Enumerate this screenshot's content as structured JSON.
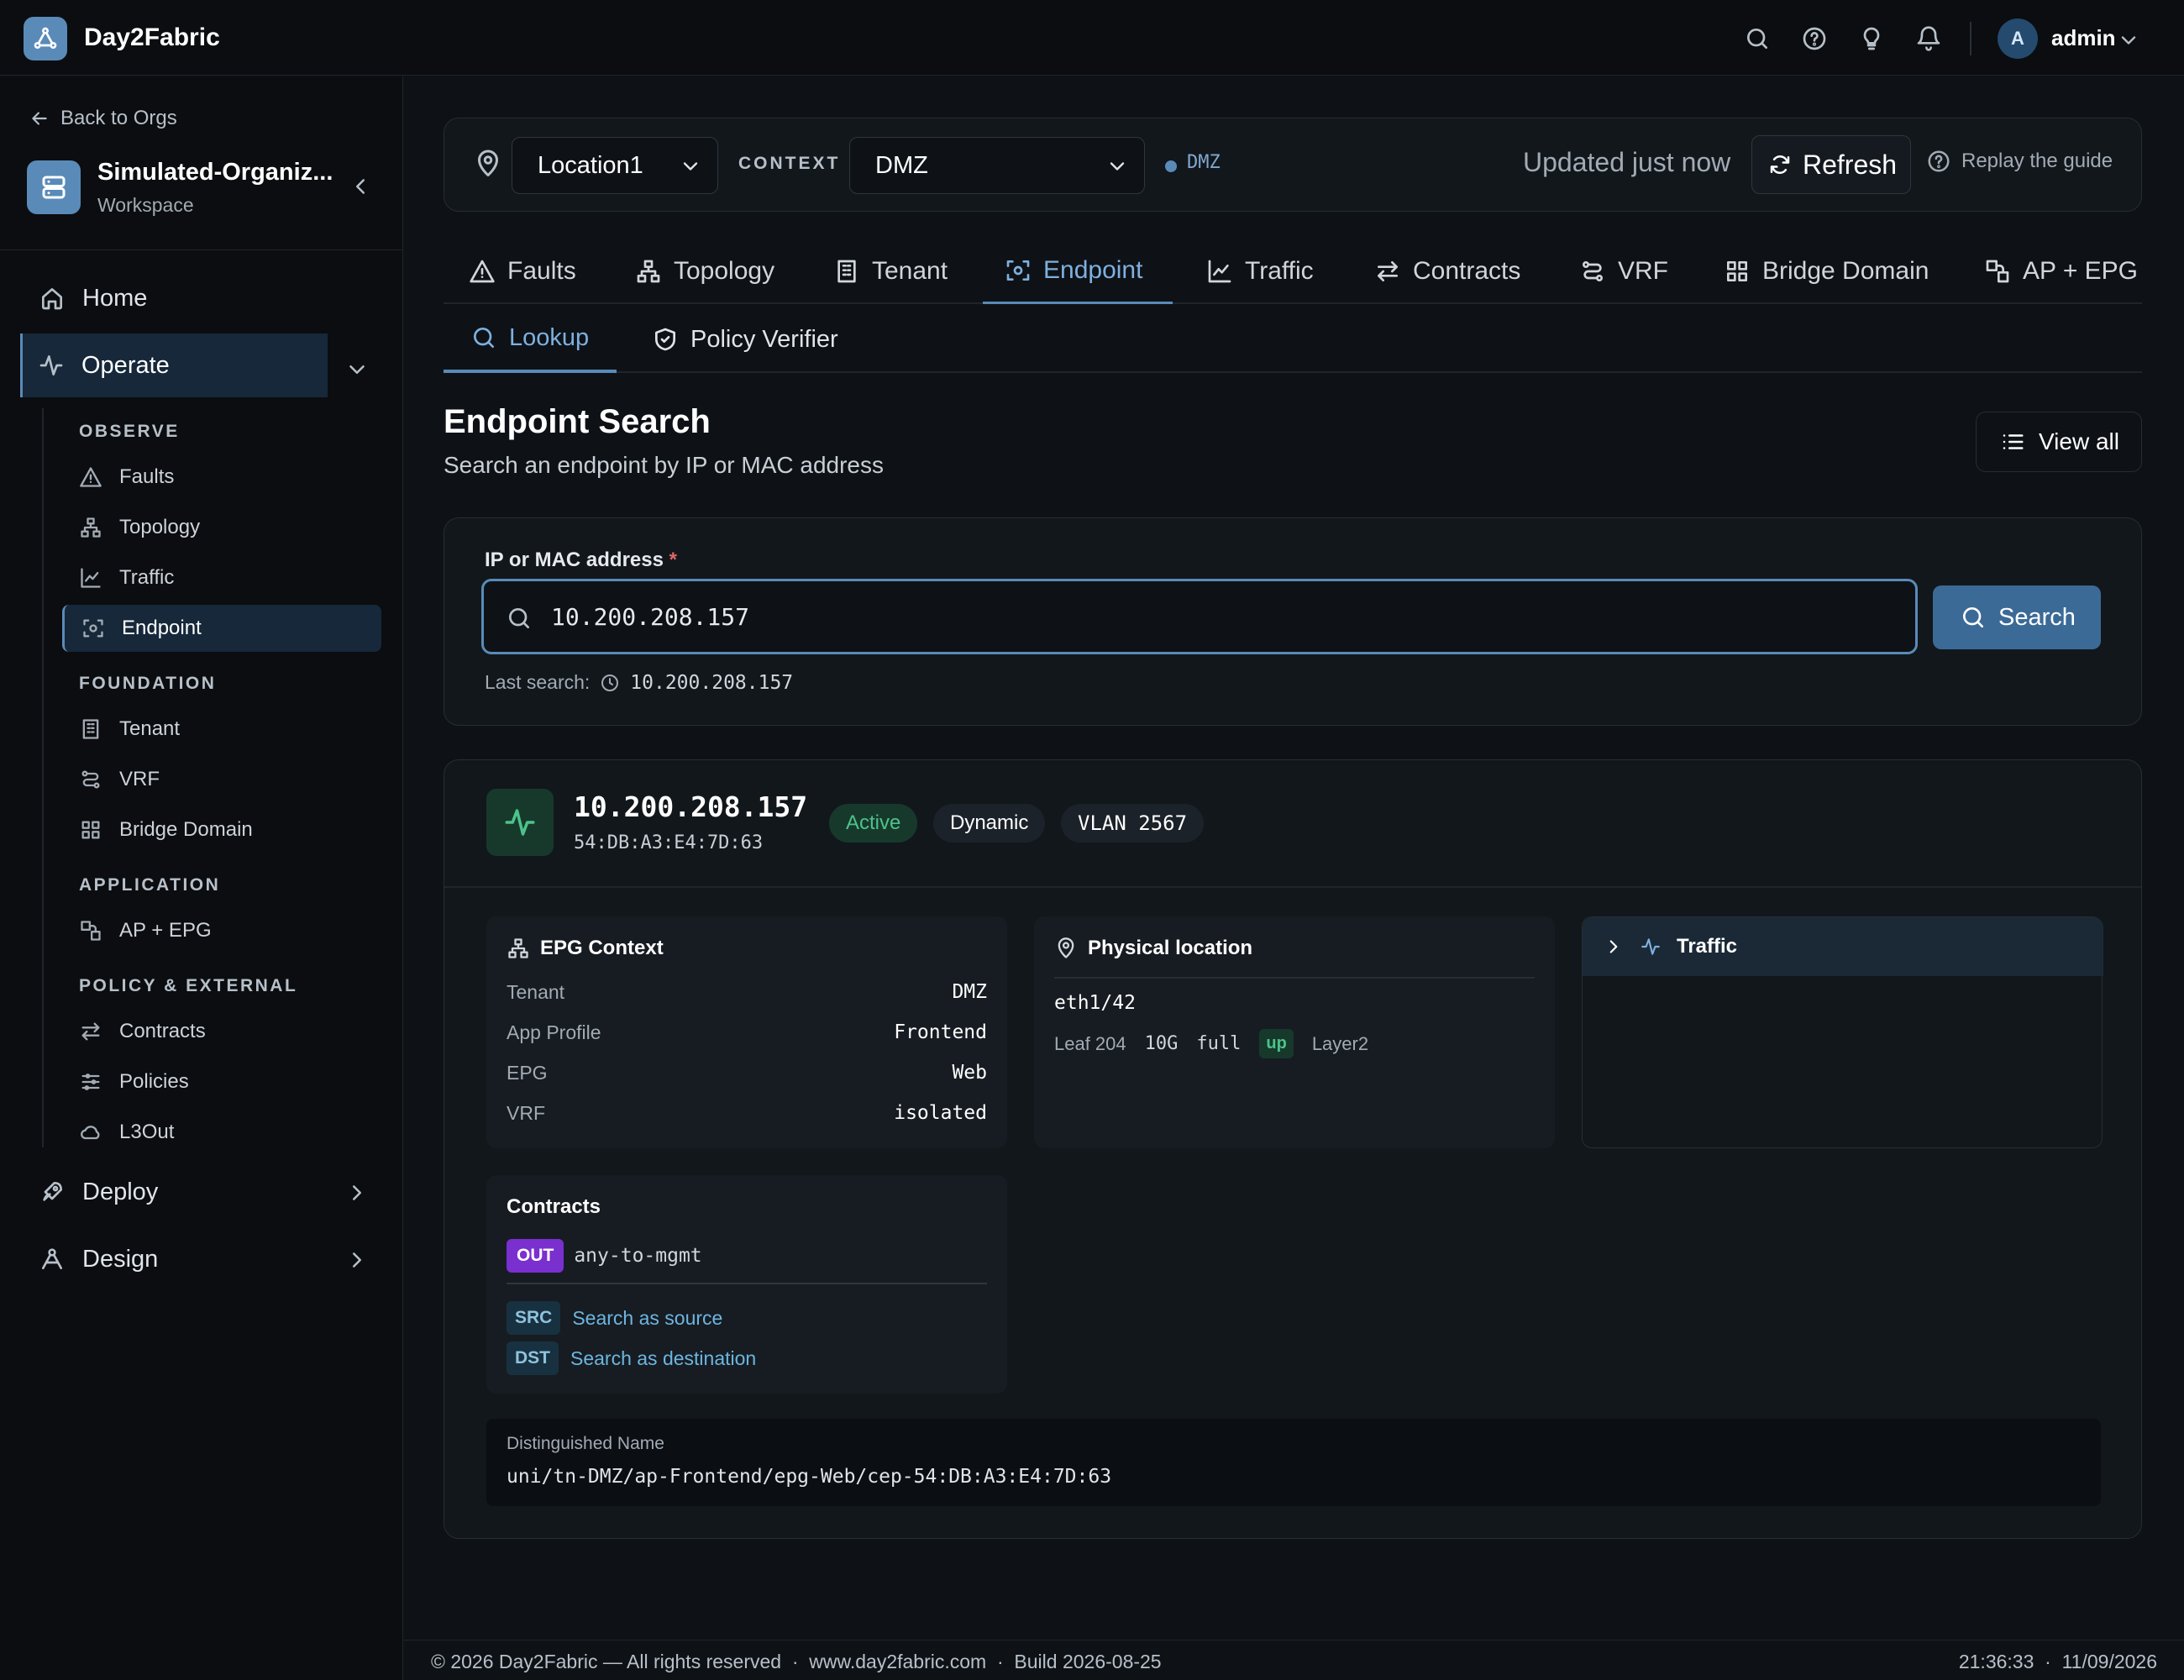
{
  "app": {
    "name": "Day2Fabric"
  },
  "user": {
    "initial": "A",
    "name": "admin"
  },
  "sidebar": {
    "back_label": "Back to Orgs",
    "org": {
      "name": "Simulated-Organiz...",
      "sub": "Workspace"
    },
    "home": "Home",
    "operate": "Operate",
    "deploy": "Deploy",
    "design": "Design",
    "sections": {
      "observe": "OBSERVE",
      "foundation": "FOUNDATION",
      "application": "APPLICATION",
      "policy": "POLICY & EXTERNAL"
    },
    "items": {
      "faults": "Faults",
      "topology": "Topology",
      "traffic": "Traffic",
      "endpoint": "Endpoint",
      "tenant": "Tenant",
      "vrf": "VRF",
      "bridge_domain": "Bridge Domain",
      "ap_epg": "AP + EPG",
      "contracts": "Contracts",
      "policies": "Policies",
      "l3out": "L3Out"
    }
  },
  "context_bar": {
    "location": "Location1",
    "context_label": "CONTEXT",
    "context": "DMZ",
    "context_badge": "DMZ",
    "updated": "Updated just now",
    "refresh": "Refresh",
    "replay": "Replay the guide"
  },
  "tabs": {
    "faults": "Faults",
    "topology": "Topology",
    "tenant": "Tenant",
    "endpoint": "Endpoint",
    "traffic": "Traffic",
    "contracts": "Contracts",
    "vrf": "VRF",
    "bridge_domain": "Bridge Domain",
    "ap_epg": "AP + EPG"
  },
  "subtabs": {
    "lookup": "Lookup",
    "policy_verifier": "Policy Verifier"
  },
  "page": {
    "title": "Endpoint Search",
    "subtitle": "Search an endpoint by IP or MAC address",
    "view_all": "View all"
  },
  "search": {
    "label": "IP or MAC address",
    "required_mark": "*",
    "value": "10.200.208.157",
    "button": "Search",
    "last_label": "Last search:",
    "last_value": "10.200.208.157"
  },
  "result": {
    "ip": "10.200.208.157",
    "mac": "54:DB:A3:E4:7D:63",
    "status": "Active",
    "type": "Dynamic",
    "vlan": "VLAN 2567",
    "epg_context": {
      "title": "EPG Context",
      "rows": [
        {
          "k": "Tenant",
          "v": "DMZ"
        },
        {
          "k": "App Profile",
          "v": "Frontend"
        },
        {
          "k": "EPG",
          "v": "Web"
        },
        {
          "k": "VRF",
          "v": "isolated"
        }
      ]
    },
    "physical": {
      "title": "Physical location",
      "port": "eth1/42",
      "leaf": "Leaf 204",
      "speed": "10G",
      "duplex": "full",
      "state": "up",
      "layer": "Layer2"
    },
    "traffic": {
      "title": "Traffic"
    },
    "contracts": {
      "title": "Contracts",
      "direction": "OUT",
      "name": "any-to-mgmt",
      "src_tag": "SRC",
      "src_link": "Search as source",
      "dst_tag": "DST",
      "dst_link": "Search as destination"
    },
    "dn": {
      "label": "Distinguished Name",
      "value": "uni/tn-DMZ/ap-Frontend/epg-Web/cep-54:DB:A3:E4:7D:63"
    }
  },
  "footer": {
    "left": "© 2026 Day2Fabric — All rights reserved  ·  www.day2fabric.com  ·  Build 2026-08-25",
    "right": "21:36:33  ·  11/09/2026"
  }
}
